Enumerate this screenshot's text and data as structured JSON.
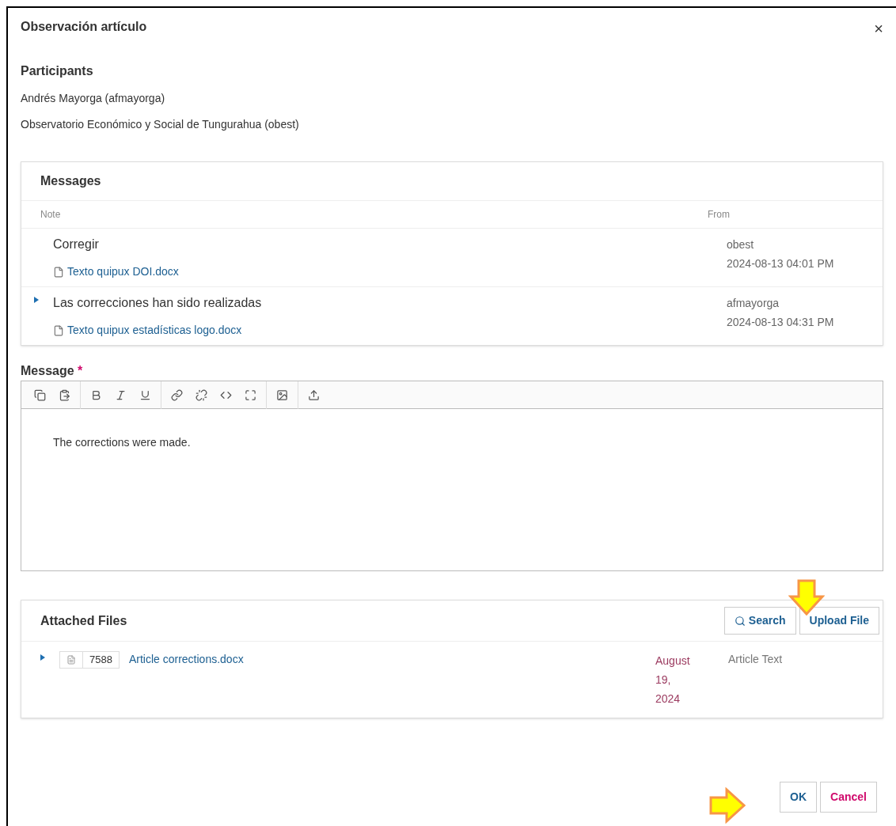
{
  "dialog": {
    "title": "Observación artículo",
    "close": "×"
  },
  "participants": {
    "heading": "Participants",
    "names": [
      "Andrés Mayorga (afmayorga)",
      "Observatorio Económico y Social de Tungurahua (obest)"
    ]
  },
  "messages": {
    "heading": "Messages",
    "columns": [
      "Note",
      "From"
    ],
    "rows": [
      {
        "toggle": false,
        "note": "Corregir",
        "file": "Texto quipux DOI.docx",
        "from": "obest",
        "date": "2024-08-13 04:01 PM"
      },
      {
        "toggle": true,
        "note": "Las correcciones han sido realizadas",
        "file": "Texto quipux estadísticas logo.docx",
        "from": "afmayorga",
        "date": "2024-08-13 04:31 PM"
      }
    ]
  },
  "message_field": {
    "label": "Message",
    "required_mark": "*",
    "value": "The corrections were made."
  },
  "attached_files": {
    "heading": "Attached Files",
    "buttons": [
      "Search",
      "Upload File"
    ],
    "rows": [
      {
        "toggle": true,
        "id": "7588",
        "name": "Article corrections.docx",
        "date": "August 19, 2024",
        "type": "Article Text"
      }
    ]
  },
  "buttons": [
    {
      "label": "OK",
      "kind": "primary"
    },
    {
      "label": "Cancel",
      "kind": "cancel"
    }
  ]
}
